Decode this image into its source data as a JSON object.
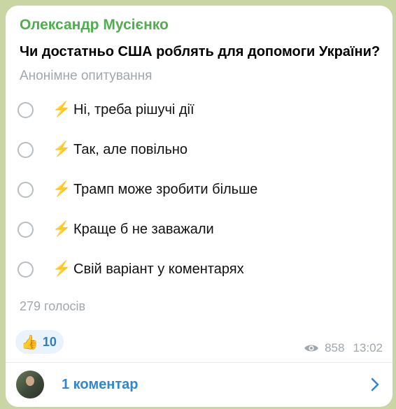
{
  "author": "Олександр Мусієнко",
  "question": "Чи достатньо США роблять для допомоги України?",
  "poll_type": "Анонімне опитування",
  "options": [
    {
      "label": "Ні, треба рішучі дії"
    },
    {
      "label": "Так, але повільно"
    },
    {
      "label": "Трамп може зробити більше"
    },
    {
      "label": "Краще б не заважали"
    },
    {
      "label": "Свій варіант у коментарях"
    }
  ],
  "option_emoji": "⚡",
  "votes": "279 голосів",
  "reaction": {
    "emoji": "👍",
    "count": "10"
  },
  "views": "858",
  "time": "13:02",
  "comments": "1 коментар",
  "icons": {
    "option": "high-voltage-emoji",
    "views": "eye-icon",
    "comments_arrow": "chevron-right-icon"
  },
  "colors": {
    "author": "#4fae4e",
    "link": "#2f87d2",
    "muted": "#a0a7ad",
    "reaction_bg": "#eaf3fc"
  }
}
